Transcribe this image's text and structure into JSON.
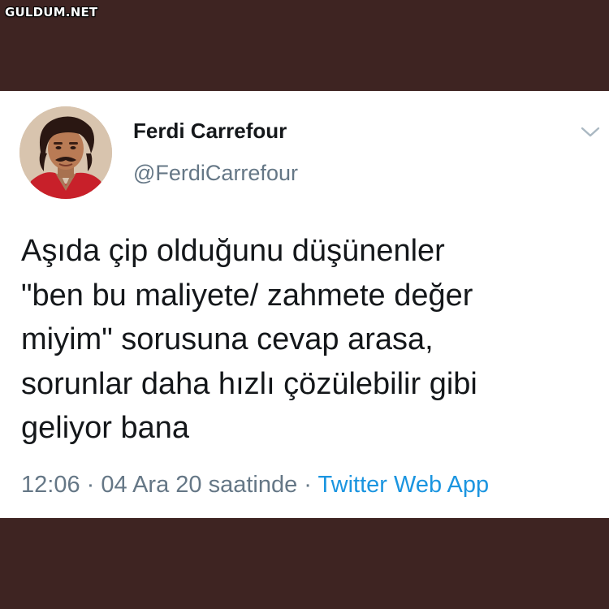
{
  "watermark": "GULDUM.NET",
  "tweet": {
    "author_name": "Ferdi Carrefour",
    "author_handle": "@FerdiCarrefour",
    "text_lines": [
      "Aşıda çip olduğunu düşünenler",
      "\"ben bu maliyete/ zahmete değer",
      "miyim\" sorusuna cevap arasa,",
      "sorunlar daha hızlı çözülebilir gibi",
      "geliyor bana"
    ],
    "time": "12:06",
    "date": "04 Ara 20 saatinde",
    "separator": "·",
    "source": "Twitter Web App"
  },
  "icons": {
    "menu": "chevron-down-icon",
    "avatar": "profile-photo"
  },
  "colors": {
    "background": "#3e2422",
    "card": "#ffffff",
    "text": "#14171a",
    "muted": "#657786",
    "link": "#1b95e0"
  }
}
